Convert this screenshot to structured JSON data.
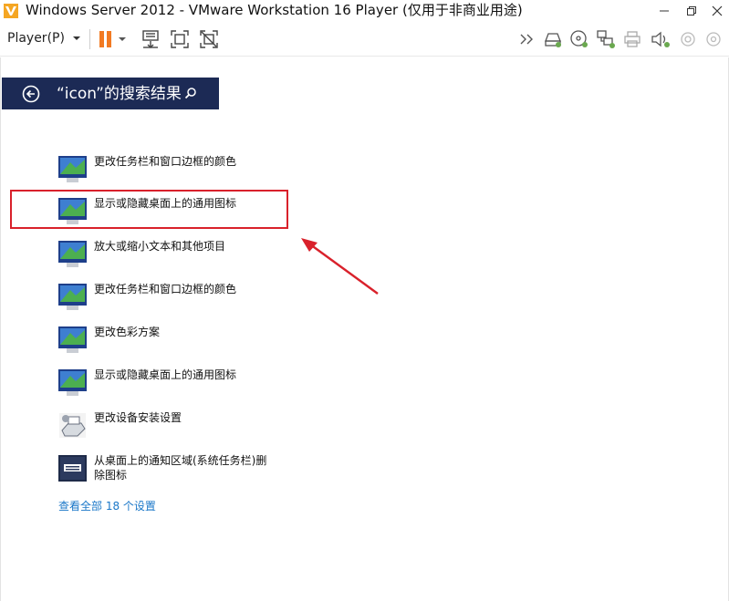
{
  "window": {
    "title": "Windows Server 2012 - VMware Workstation 16 Player (仅用于非商业用途)",
    "app_icon": "vmware-player-icon",
    "controls": [
      "minimize-icon",
      "maximize-icon",
      "close-icon"
    ]
  },
  "toolbar": {
    "player_menu": "Player(P)",
    "left_icons": [
      "pause-icon",
      "send-ctrl-alt-del-icon",
      "fit-guest-icon",
      "unity-icon"
    ],
    "right_icons": [
      "more-devices-icon",
      "hard-disk-icon",
      "cd-dvd-icon",
      "network-adapter-icon",
      "printer-icon",
      "sound-card-icon",
      "usb-icon"
    ]
  },
  "search": {
    "title": "“icon”的搜索结果",
    "back_icon": "back-arrow-icon",
    "search_icon": "search-icon"
  },
  "results": [
    {
      "label": "更改任务栏和窗口边框的颜色",
      "icon": "display-icon"
    },
    {
      "label": "显示或隐藏桌面上的通用图标",
      "icon": "display-icon"
    },
    {
      "label": "放大或缩小文本和其他项目",
      "icon": "display-icon"
    },
    {
      "label": "更改任务栏和窗口边框的颜色",
      "icon": "display-icon"
    },
    {
      "label": "更改色彩方案",
      "icon": "display-icon"
    },
    {
      "label": "显示或隐藏桌面上的通用图标",
      "icon": "display-icon"
    },
    {
      "label": "更改设备安装设置",
      "icon": "device-installation-icon"
    },
    {
      "label": "从桌面上的通知区域(系统任务栏)删除图标",
      "icon": "notification-area-icon"
    }
  ],
  "see_all": "查看全部 18 个设置",
  "colors": {
    "header_bg": "#1c2a55",
    "link": "#1a77c8",
    "highlight": "#d9212b",
    "pause": "#f27a22"
  }
}
